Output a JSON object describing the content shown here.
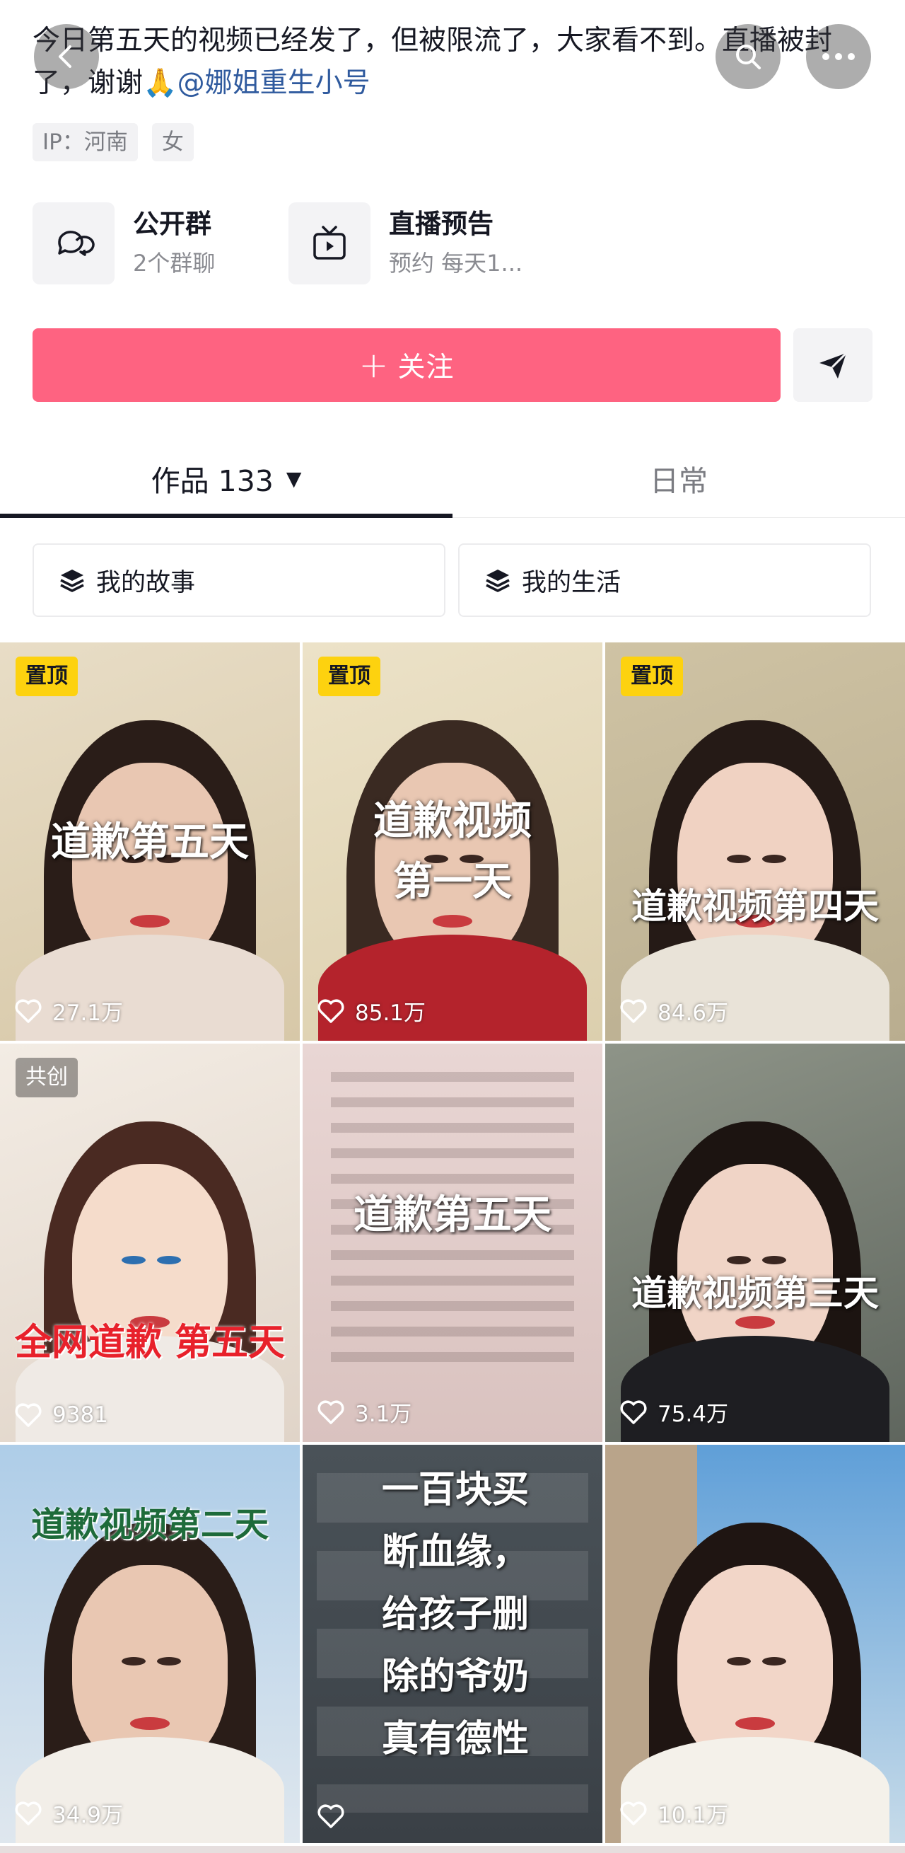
{
  "header": {
    "bio_text": "今日第五天的视频已经发了，但被限流了，大家看不到。直播被封了，谢谢🙏",
    "bio_mention": "@娜姐重生小号",
    "back_icon": "chevron-left-icon",
    "search_icon": "search-icon",
    "more_icon": "more-icon"
  },
  "tags": [
    "IP：河南",
    "女"
  ],
  "entries": [
    {
      "title": "公开群",
      "sub": "2个群聊",
      "icon": "chat-bubbles-icon"
    },
    {
      "title": "直播预告",
      "sub": "预约 每天1...",
      "icon": "tv-icon"
    }
  ],
  "follow": {
    "label": "关注",
    "plus": "+"
  },
  "tabs": {
    "works_label": "作品 133",
    "daily_label": "日常"
  },
  "collections": [
    "我的故事",
    "我的生活"
  ],
  "grid": [
    {
      "badge": "置顶",
      "badge_type": "pin",
      "overlay": "道歉第五天",
      "likes": "27.1万"
    },
    {
      "badge": "置顶",
      "badge_type": "pin",
      "overlay": "道歉视频\n第一天",
      "likes": "85.1万"
    },
    {
      "badge": "置顶",
      "badge_type": "pin",
      "overlay": "道歉视频第四天",
      "likes": "84.6万"
    },
    {
      "badge": "共创",
      "badge_type": "co",
      "overlay": "全网道歉 第五天",
      "likes": "9381"
    },
    {
      "badge": "",
      "badge_type": "",
      "overlay": "道歉第五天",
      "likes": "3.1万"
    },
    {
      "badge": "",
      "badge_type": "",
      "overlay": "道歉视频第三天",
      "likes": "75.4万"
    },
    {
      "badge": "",
      "badge_type": "",
      "overlay": "道歉视频第二天",
      "likes": "34.9万"
    },
    {
      "badge": "",
      "badge_type": "",
      "overlay": "一百块买\n断血缘，\n给孩子删\n除的爷奶\n真有德性",
      "likes": ""
    },
    {
      "badge": "",
      "badge_type": "",
      "overlay": "",
      "likes": "10.1万"
    }
  ],
  "colors": {
    "follow_bg": "#fe6381",
    "pin_badge": "#fdd20f",
    "mention": "#2f5a9e"
  }
}
